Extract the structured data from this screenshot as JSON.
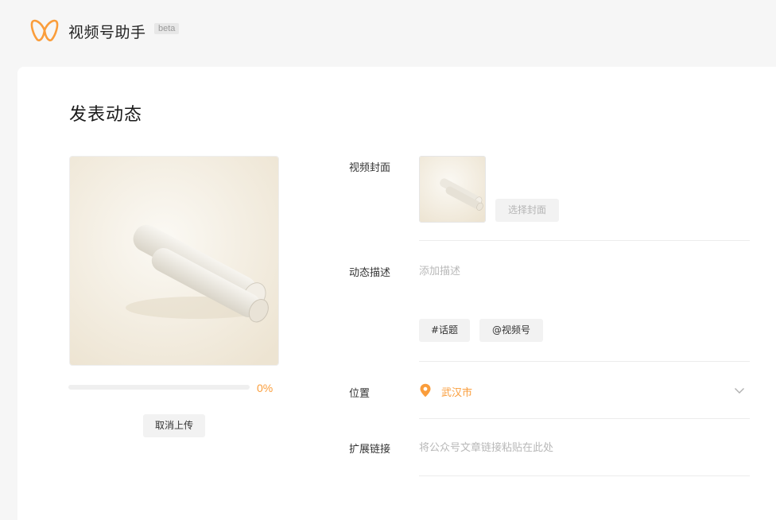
{
  "header": {
    "app_name": "视频号助手",
    "badge": "beta",
    "logo_icon": "butterfly-logo-icon"
  },
  "page": {
    "title": "发表动态"
  },
  "upload": {
    "progress_percent": 0,
    "progress_text": "0%",
    "cancel_label": "取消上传"
  },
  "form": {
    "cover": {
      "label": "视频封面",
      "choose_label": "选择封面"
    },
    "description": {
      "label": "动态描述",
      "placeholder": "添加描述",
      "value": "",
      "topic_label": "#话题",
      "mention_label": "@视频号"
    },
    "location": {
      "label": "位置",
      "value": "武汉市",
      "icon": "location-pin-icon"
    },
    "link": {
      "label": "扩展链接",
      "placeholder": "将公众号文章链接粘贴在此处",
      "value": ""
    }
  },
  "colors": {
    "accent": "#fa9d3b",
    "card_bg": "#ffffff",
    "page_bg": "#f6f6f6"
  }
}
